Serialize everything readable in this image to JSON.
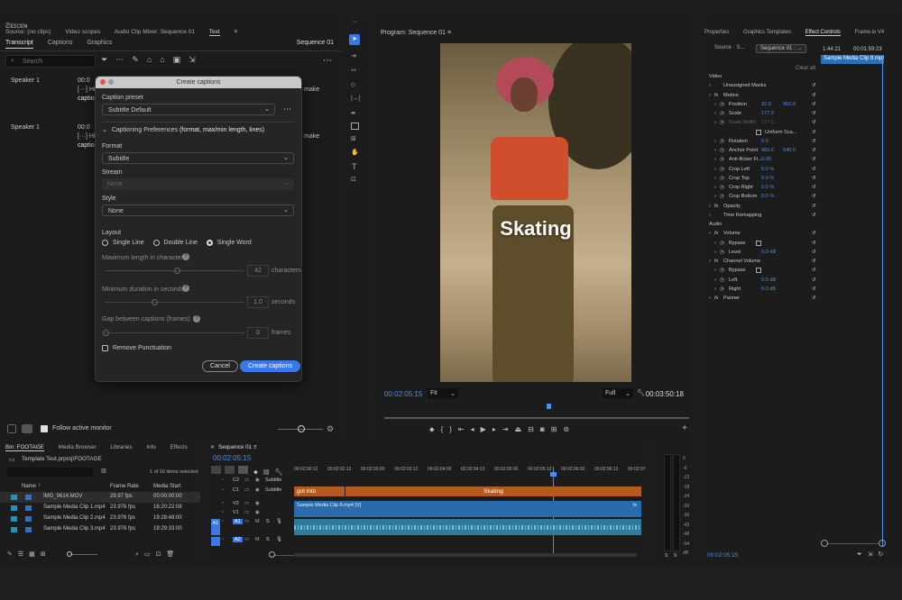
{
  "source_panel": {
    "label": "Source: (no clips)",
    "tabs": [
      "Source: (no clips)",
      "Video scopes",
      "Audio Clip Mixer: Sequence 01",
      "Text"
    ],
    "subtabs": [
      "Transcript",
      "Captions",
      "Graphics"
    ],
    "sequence": "Sequence 01",
    "search_placeholder": "Search"
  },
  "transcript": [
    {
      "speaker": "Speaker 1",
      "time": "00:0",
      "line1": "[···] Hi",
      "line2": "caption",
      "end": "make"
    },
    {
      "speaker": "Speaker 1",
      "time": "00:0",
      "line1": "[···] Hi",
      "line2": "caption",
      "end": "make"
    }
  ],
  "dialog": {
    "title": "Create captions",
    "preset_label": "Caption preset",
    "preset_value": "Subtitle Default",
    "prefs_label": "Captioning Preferences",
    "prefs_hint": "(format, max/min length, lines)",
    "format_label": "Format",
    "format_value": "Subtitle",
    "stream_label": "Stream",
    "stream_value": "None",
    "style_label": "Style",
    "style_value": "None",
    "layout_label": "Layout",
    "layout_options": [
      "Single Line",
      "Double Line",
      "Single Word"
    ],
    "max_label": "Maximum length in characters",
    "max_value": "42",
    "max_unit": "characters",
    "min_label": "Minimum duration in seconds",
    "min_value": "1.0",
    "min_unit": "seconds",
    "gap_label": "Gap between captions (frames)",
    "gap_value": "0",
    "gap_unit": "frames",
    "remove_punct": "Remove Punctuation",
    "cancel": "Cancel",
    "create": "Create captions"
  },
  "follow_monitor": "Follow active monitor",
  "program": {
    "title": "Program: Sequence 01",
    "caption": "Skating",
    "timecode": "00:02:05:15",
    "fit": "Fit",
    "quality": "Full",
    "duration": "00:03:50:18"
  },
  "effect_controls": {
    "tabs": [
      "Properties",
      "Graphics Templates",
      "Effect Controls",
      "Frame.io V4"
    ],
    "source": "Source · S...",
    "sequence": "Sequence 01 · ...",
    "time_a": "1:44:21",
    "time_b": "00:01:59:23",
    "clip": "Sample Media Clip 8.mp4",
    "clear_all": "Clear all",
    "footer_time": "00:02:05:15",
    "rows": [
      {
        "label": "Video",
        "indent": 0
      },
      {
        "label": "Unassigned Masks",
        "indent": 1
      },
      {
        "label": "Motion",
        "indent": 1,
        "fx": true
      },
      {
        "label": "Position",
        "indent": 2,
        "v1": "32.0",
        "v2": "960.0"
      },
      {
        "label": "Scale",
        "indent": 2,
        "v1": "177.0"
      },
      {
        "label": "Scale Width",
        "indent": 2,
        "v1": "177.0",
        "dim": true
      },
      {
        "label": "Uniform Sca...",
        "indent": 4,
        "check": true
      },
      {
        "label": "Rotation",
        "indent": 2,
        "v1": "0.0"
      },
      {
        "label": "Anchor Point",
        "indent": 2,
        "v1": "960.0",
        "v2": "540.0"
      },
      {
        "label": "Anti-flicker Fi...",
        "indent": 2,
        "v1": "0.00"
      },
      {
        "label": "Crop Left",
        "indent": 2,
        "v1": "0.0 %"
      },
      {
        "label": "Crop Top",
        "indent": 2,
        "v1": "0.0 %"
      },
      {
        "label": "Crop Right",
        "indent": 2,
        "v1": "0.0 %"
      },
      {
        "label": "Crop Bottom",
        "indent": 2,
        "v1": "0.0 %"
      },
      {
        "label": "Opacity",
        "indent": 1,
        "fx": true
      },
      {
        "label": "Time Remapping",
        "indent": 1
      },
      {
        "label": "Audio",
        "indent": 0
      },
      {
        "label": "Volume",
        "indent": 1,
        "fx": true
      },
      {
        "label": "Bypass",
        "indent": 2,
        "check": true
      },
      {
        "label": "Level",
        "indent": 2,
        "v1": "0.0 dB"
      },
      {
        "label": "Channel Volume",
        "indent": 1,
        "fx": true
      },
      {
        "label": "Bypass",
        "indent": 2,
        "check": true
      },
      {
        "label": "Left",
        "indent": 2,
        "v1": "0.0 dB"
      },
      {
        "label": "Right",
        "indent": 2,
        "v1": "0.0 dB"
      },
      {
        "label": "Panner",
        "indent": 1,
        "fx": true
      }
    ]
  },
  "project": {
    "tabs": [
      "Bin: FOOTAGE",
      "Media Browser",
      "Libraries",
      "Info",
      "Effects"
    ],
    "path": "Template Test.prproj\\FOOTAGE",
    "count": "1 of 16 items selected",
    "headers": [
      "Name",
      "Frame Rate",
      "Media Start"
    ],
    "items": [
      {
        "name": "IMG_9614.MOV",
        "rate": "29.97 fps",
        "start": "00:00:00:00"
      },
      {
        "name": "Sample Media Clip 1.mp4",
        "rate": "23.976 fps",
        "start": "16:20:22:08"
      },
      {
        "name": "Sample Media Clip 2.mp4",
        "rate": "23.976 fps",
        "start": "19:28:48:00"
      },
      {
        "name": "Sample Media Clip 3.mp4",
        "rate": "23.976 fps",
        "start": "19:29:33:00"
      }
    ]
  },
  "timeline": {
    "title": "Sequence 01",
    "timecode": "00:02:05:15",
    "ruler": [
      "00:02:00:12",
      "00:02:02:12",
      "00:02:03:00",
      "00:02:03:12",
      "00:02:04:00",
      "00:02:04:12",
      "00:02:05:00",
      "00:02:05:12",
      "00:02:06:00",
      "00:02:06:12",
      "00:02:07:"
    ],
    "tracks": [
      {
        "id": "C2",
        "name": "Subtitle"
      },
      {
        "id": "C1",
        "name": "Subtitle"
      },
      {
        "id": "V2",
        "name": ""
      },
      {
        "id": "V1",
        "name": ""
      },
      {
        "id": "A1",
        "name": ""
      },
      {
        "id": "A2",
        "name": ""
      }
    ],
    "caption_clips": [
      "got into",
      "Skating"
    ],
    "video_clip": "Sample Media Clip 8.mp4 [V]",
    "fx_badge": "fx"
  },
  "meter": {
    "scale": [
      "0",
      "-6",
      "-12",
      "-18",
      "-24",
      "-30",
      "-36",
      "-42",
      "-48",
      "-54",
      "dB"
    ],
    "solo": [
      "S",
      "S"
    ]
  }
}
